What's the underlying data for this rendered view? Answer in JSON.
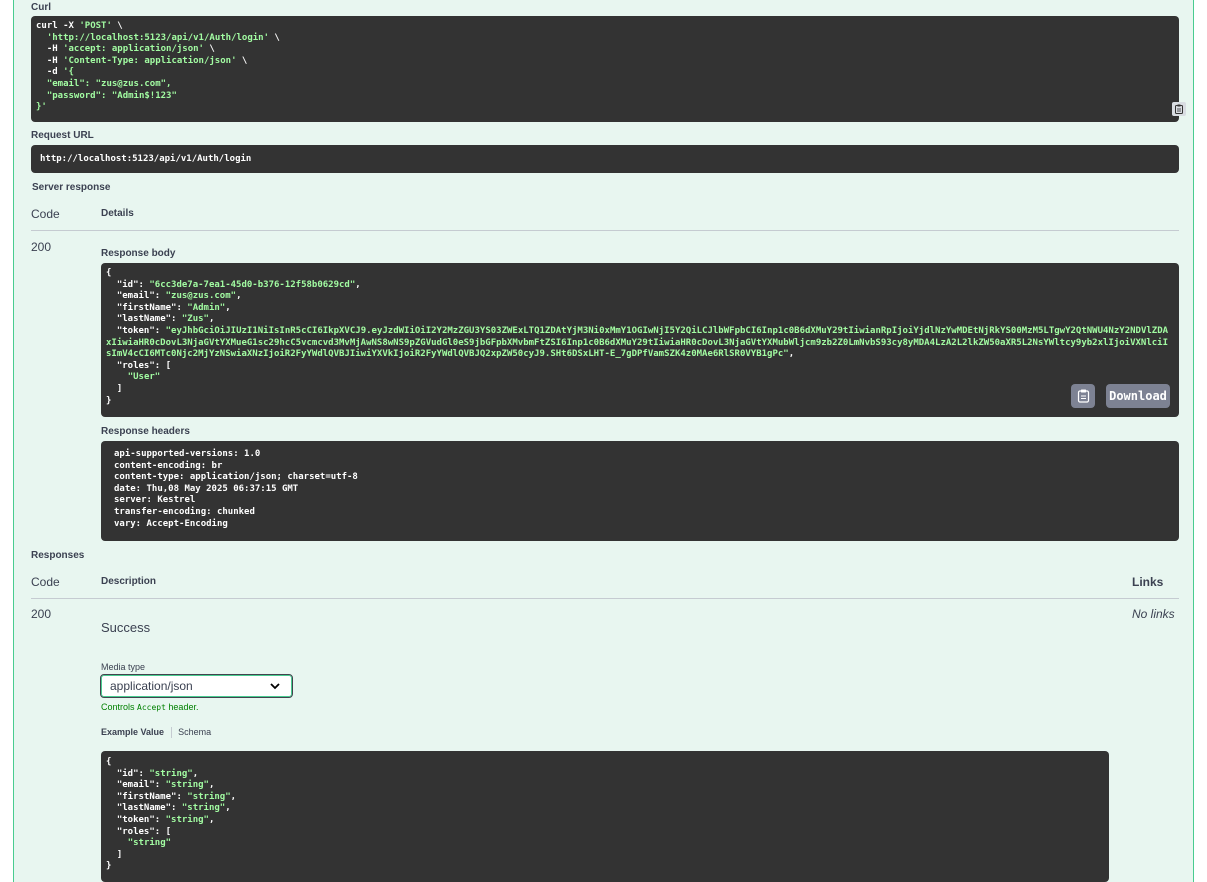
{
  "curl": {
    "label": "Curl",
    "lines": [
      {
        "pre": "curl -X ",
        "str": "'POST'",
        "post": " \\"
      },
      {
        "pre": "  ",
        "str": "'http://localhost:5123/api/v1/Auth/login'",
        "post": " \\"
      },
      {
        "pre": "  -H ",
        "str": "'accept: application/json'",
        "post": " \\"
      },
      {
        "pre": "  -H ",
        "str": "'Content-Type: application/json'",
        "post": " \\"
      },
      {
        "pre": "  -d ",
        "str": "'{",
        "post": ""
      },
      {
        "pre": "",
        "str": "  \"email\": \"zus@zus.com\",",
        "post": ""
      },
      {
        "pre": "",
        "str": "  \"password\": \"Admin$!123\"",
        "post": ""
      },
      {
        "pre": "",
        "str": "}'",
        "post": ""
      }
    ]
  },
  "request_url": {
    "label": "Request URL",
    "value": "http://localhost:5123/api/v1/Auth/login"
  },
  "server_response": {
    "label": "Server response",
    "col_code": "Code",
    "col_details": "Details",
    "code": "200",
    "body_label": "Response body",
    "body": {
      "id": "6cc3de7a-7ea1-45d0-b376-12f58b0629cd",
      "email": "zus@zus.com",
      "firstName": "Admin",
      "lastName": "Zus",
      "token": "eyJhbGciOiJIUzI1NiIsInR5cCI6IkpXVCJ9.eyJzdWIiOiI2Y2MzZGU3YS03ZWExLTQ1ZDAtYjM3Ni0xMmY1OGIwNjI5Y2QiLCJlbWFpbCI6Inp1c0B6dXMuY29tIiwianRpIjoiYjdlNzYwMDEtNjRkYS00MzM5LTgwY2QtNWU4NzY2NDVlZDAxIiwiaHR0cDovL3NjaGVtYXMueG1sc29hcC5vcmcvd3MvMjAwNS8wNS9pZGVudGl0eS9jbGFpbXMvbmFtZSI6Inp1c0B6dXMuY29tIiwiaHR0cDovL3NjaGVtYXMubWljcm9zb2Z0LmNvbS93cy8yMDA4LzA2L2lkZW50aXR5L2NsYWltcy9yb2xlIjoiVXNlciIsImV4cCI6MTc0Njc2MjYzNSwiaXNzIjoiR2FyYWdlQVBJIiwiYXVkIjoiR2FyYWdlQVBJQ2xpZW50cyJ9.SHt6DSxLHT-E_7gDPfVamSZK4z0MAe6RlSR0VYB1gPc",
      "role": "User"
    },
    "download_label": "Download",
    "headers_label": "Response headers",
    "headers": [
      "api-supported-versions: 1.0",
      "content-encoding: br",
      "content-type: application/json; charset=utf-8",
      "date: Thu,08 May 2025 06:37:15 GMT",
      "server: Kestrel",
      "transfer-encoding: chunked",
      "vary: Accept-Encoding"
    ]
  },
  "responses": {
    "label": "Responses",
    "col_code": "Code",
    "col_description": "Description",
    "col_links": "Links",
    "code": "200",
    "description": "Success",
    "links": "No links",
    "media_type_label": "Media type",
    "media_type_value": "application/json",
    "controls_pre": "Controls ",
    "controls_code": "Accept",
    "controls_post": " header.",
    "tab_example": "Example Value",
    "tab_schema": "Schema",
    "example": {
      "id": "string",
      "email": "string",
      "firstName": "string",
      "lastName": "string",
      "token": "string",
      "role": "string"
    }
  },
  "colors": {
    "panel_bg": "#e8f6f0",
    "border_green": "#49cc90",
    "code_bg": "#333333",
    "string_green": "#a2fca2",
    "button_gray": "#7d8293"
  }
}
